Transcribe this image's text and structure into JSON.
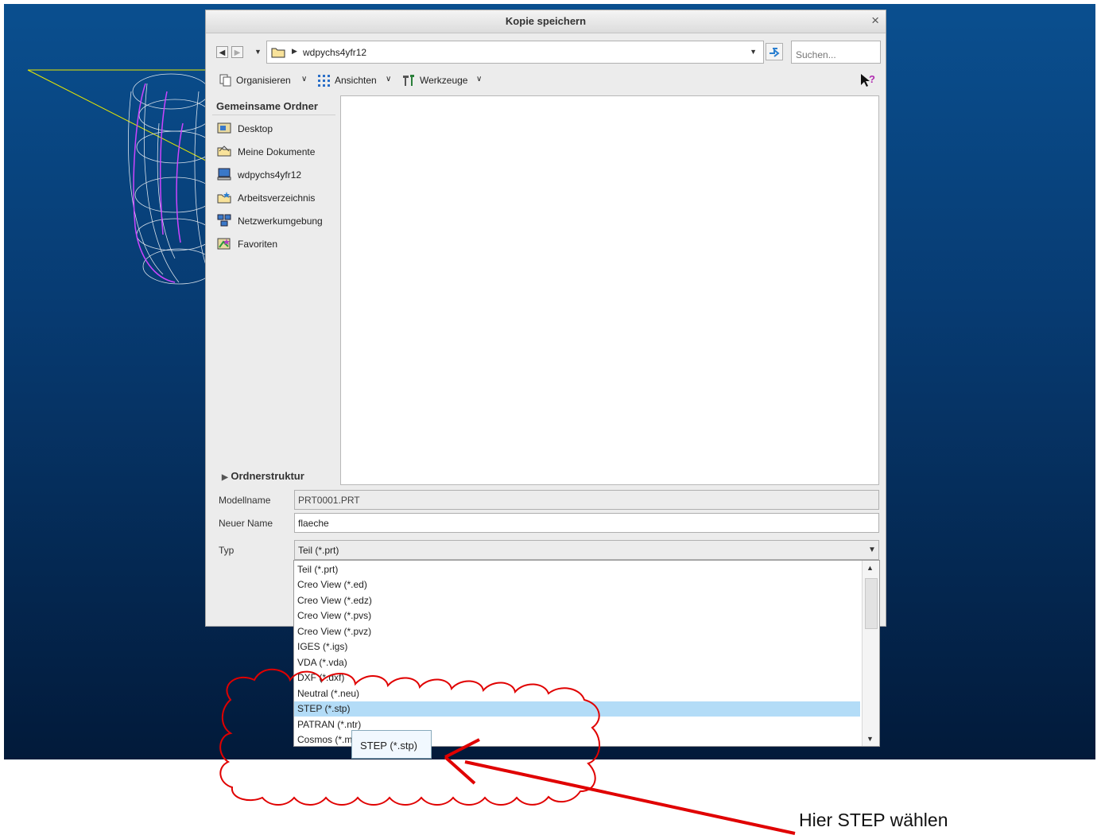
{
  "dialog": {
    "title": "Kopie speichern",
    "close_glyph": "×",
    "path_folder": "wdpychs4yfr12",
    "search_placeholder": "Suchen...",
    "toolbar": {
      "organize": "Organisieren",
      "views": "Ansichten",
      "tools": "Werkzeuge"
    },
    "sidebar": {
      "heading": "Gemeinsame Ordner",
      "items": [
        {
          "label": "Desktop",
          "icon": "desktop-icon"
        },
        {
          "label": "Meine Dokumente",
          "icon": "documents-folder-icon"
        },
        {
          "label": "wdpychs4yfr12",
          "icon": "computer-icon"
        },
        {
          "label": "Arbeitsverzeichnis",
          "icon": "working-folder-icon"
        },
        {
          "label": "Netzwerkumgebung",
          "icon": "network-icon"
        },
        {
          "label": "Favoriten",
          "icon": "favorites-icon"
        }
      ],
      "tree_label": "Ordnerstruktur"
    },
    "fields": {
      "model_label": "Modellname",
      "model_value": "PRT0001.PRT",
      "new_name_label": "Neuer Name",
      "new_name_value": "flaeche",
      "type_label": "Typ",
      "type_value": "Teil (*.prt)"
    },
    "type_options": [
      "Teil (*.prt)",
      "Creo View (*.ed)",
      "Creo View (*.edz)",
      "Creo View (*.pvs)",
      "Creo View (*.pvz)",
      "IGES (*.igs)",
      "VDA (*.vda)",
      "DXF (*.dxf)",
      "Neutral (*.neu)",
      "STEP (*.stp)",
      "PATRAN (*.ntr)",
      "Cosmos (*.mod)"
    ],
    "selected_option": "STEP (*.stp)",
    "tooltip": "STEP (*.stp)"
  },
  "annotation": {
    "text": "Hier STEP wählen",
    "color": "#e00000"
  },
  "colors": {
    "viewport_top": "#0a4f8f",
    "viewport_bottom": "#021a3a",
    "selection": "#b3dcf7",
    "wireframe": "#ffffff",
    "highlight_edge": "#cc44ff",
    "datum_line": "#e8e800"
  }
}
